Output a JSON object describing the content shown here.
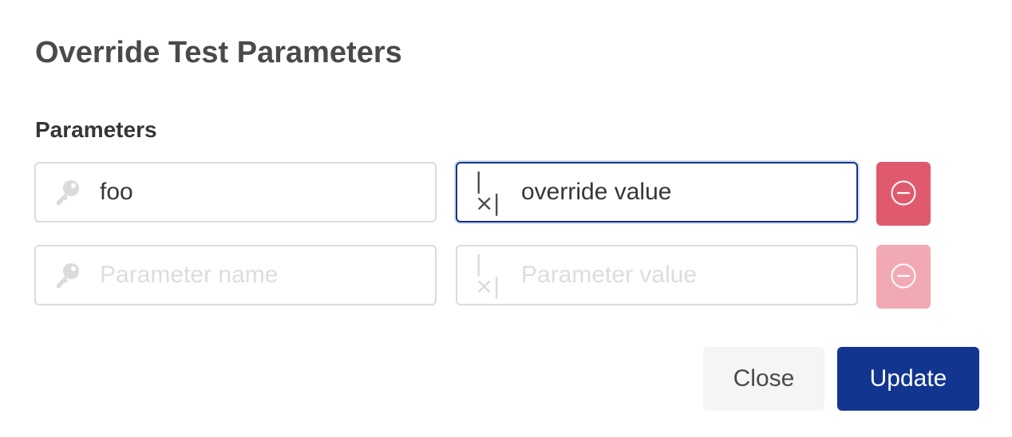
{
  "dialog": {
    "title": "Override Test Parameters",
    "section_label": "Parameters"
  },
  "parameters": [
    {
      "name_value": "foo",
      "name_placeholder": "Parameter name",
      "value_value": "override value",
      "value_placeholder": "Parameter value",
      "name_icon": "key-icon",
      "value_icon": "variable-icon",
      "remove_icon": "minus-circle-icon",
      "remove_enabled": true
    },
    {
      "name_value": "",
      "name_placeholder": "Parameter name",
      "value_value": "",
      "value_placeholder": "Parameter value",
      "name_icon": "key-icon",
      "value_icon": "variable-icon",
      "remove_icon": "minus-circle-icon",
      "remove_enabled": false
    }
  ],
  "footer": {
    "close_label": "Close",
    "update_label": "Update"
  },
  "icons": {
    "variable_glyph": "|×|"
  },
  "colors": {
    "primary": "#12358f",
    "danger": "#e05a6e",
    "danger_disabled": "#f1aab4",
    "text_dark": "#4a4a4a",
    "placeholder": "#dddddd",
    "border": "#dbdbdb"
  }
}
